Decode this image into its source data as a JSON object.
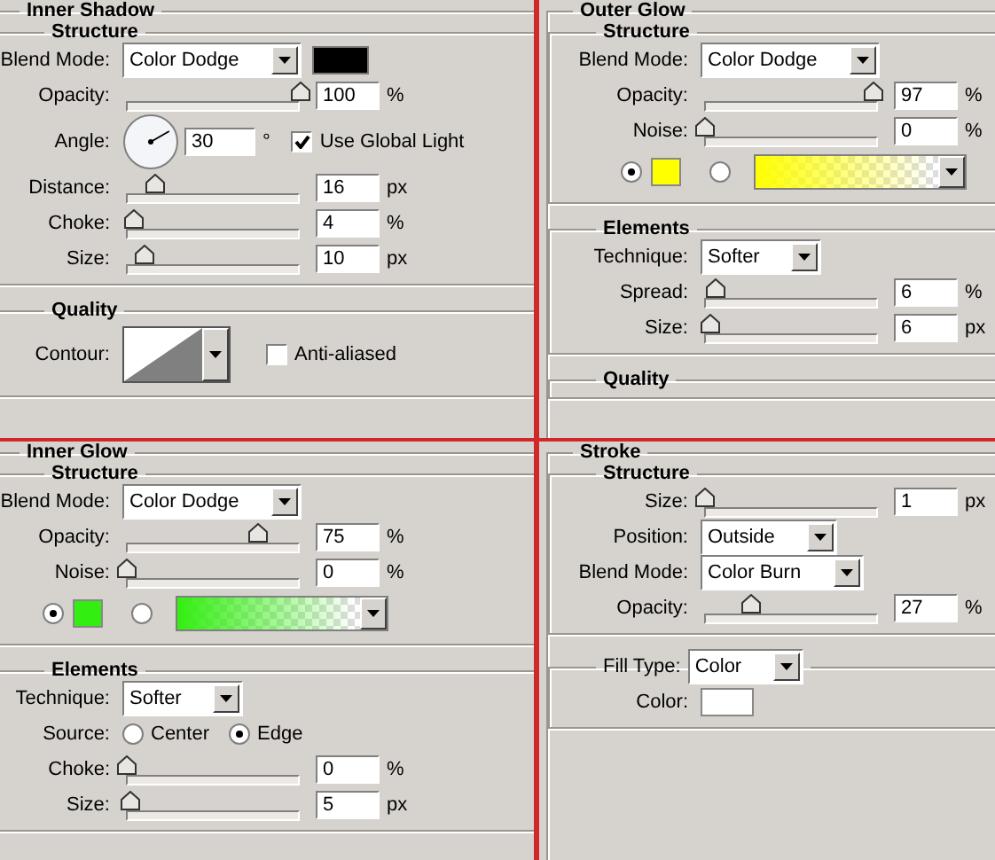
{
  "panels": [
    {
      "title": "Inner Shadow",
      "sections": [
        {
          "kind": "plain",
          "title": "Structure",
          "rows": [
            {
              "kind": "select",
              "label": "Blend Mode:",
              "value": "Color Dodge",
              "color": "#000000"
            },
            {
              "kind": "slider",
              "label": "Opacity:",
              "level": 1.0,
              "value": "100",
              "unit": "%"
            },
            {
              "kind": "angle",
              "label": "Angle:",
              "value": "30",
              "unit": "°",
              "checkbox": {
                "label": "Use Global Light",
                "checked": true
              }
            },
            {
              "kind": "slider",
              "label": "Distance:",
              "level": 0.16,
              "value": "16",
              "unit": "px"
            },
            {
              "kind": "slider",
              "label": "Choke:",
              "level": 0.04,
              "value": "4",
              "unit": "%"
            },
            {
              "kind": "slider",
              "label": "Size:",
              "level": 0.1,
              "value": "10",
              "unit": "px"
            }
          ]
        },
        {
          "kind": "plain",
          "title": "Quality",
          "rows": [
            {
              "kind": "contour",
              "label": "Contour:",
              "checkbox": {
                "label": "Anti-aliased",
                "checked": false
              }
            }
          ]
        }
      ]
    },
    {
      "title": "Outer Glow",
      "sections": [
        {
          "kind": "plain",
          "title": "Structure",
          "rows": [
            {
              "kind": "select",
              "label": "Blend Mode:",
              "value": "Color Dodge"
            },
            {
              "kind": "slider",
              "label": "Opacity:",
              "level": 0.97,
              "value": "97",
              "unit": "%"
            },
            {
              "kind": "slider",
              "label": "Noise:",
              "level": 0,
              "value": "0",
              "unit": "%"
            },
            {
              "kind": "fill",
              "options": [
                {
                  "kind": "solid",
                  "selected": true,
                  "color": "#ffff00"
                },
                {
                  "kind": "gradient",
                  "selected": false,
                  "color": "#ffff00"
                }
              ]
            }
          ]
        },
        {
          "kind": "plain",
          "title": "Elements",
          "rows": [
            {
              "kind": "select",
              "label": "Technique:",
              "value": "Softer"
            },
            {
              "kind": "slider",
              "label": "Spread:",
              "level": 0.06,
              "value": "6",
              "unit": "%"
            },
            {
              "kind": "slider",
              "label": "Size:",
              "level": 0.03,
              "value": "6",
              "unit": "px"
            }
          ]
        },
        {
          "kind": "plain",
          "title": "Quality"
        }
      ]
    },
    {
      "title": "Inner Glow",
      "sections": [
        {
          "kind": "plain",
          "title": "Structure",
          "rows": [
            {
              "kind": "select",
              "label": "Blend Mode:",
              "value": "Color Dodge"
            },
            {
              "kind": "slider",
              "label": "Opacity:",
              "level": 0.75,
              "value": "75",
              "unit": "%"
            },
            {
              "kind": "slider",
              "label": "Noise:",
              "level": 0,
              "value": "0",
              "unit": "%"
            },
            {
              "kind": "fill",
              "options": [
                {
                  "kind": "solid",
                  "selected": true,
                  "color": "#33ee11"
                },
                {
                  "kind": "gradient",
                  "selected": false,
                  "color": "#33ee11"
                }
              ]
            }
          ]
        },
        {
          "kind": "plain",
          "title": "Elements",
          "rows": [
            {
              "kind": "select",
              "label": "Technique:",
              "value": "Softer"
            },
            {
              "kind": "radios",
              "label": "Source:",
              "options": [
                {
                  "label": "Center",
                  "selected": false
                },
                {
                  "label": "Edge",
                  "selected": true
                }
              ]
            },
            {
              "kind": "slider",
              "label": "Choke:",
              "level": 0,
              "value": "0",
              "unit": "%"
            },
            {
              "kind": "slider",
              "label": "Size:",
              "level": 0.02,
              "value": "5",
              "unit": "px"
            }
          ]
        }
      ]
    },
    {
      "title": "Stroke",
      "sections": [
        {
          "kind": "plain",
          "title": "Structure",
          "rows": [
            {
              "kind": "slider",
              "label": "Size:",
              "level": 0,
              "value": "1",
              "unit": "px"
            },
            {
              "kind": "select",
              "label": "Position:",
              "value": "Outside"
            },
            {
              "kind": "select",
              "label": "Blend Mode:",
              "value": "Color Burn"
            },
            {
              "kind": "slider",
              "label": "Opacity:",
              "level": 0.27,
              "value": "27",
              "unit": "%"
            }
          ]
        },
        {
          "kind": "select",
          "title": "Fill Type:",
          "value": "Color",
          "rows": [
            {
              "kind": "swatch",
              "label": "Color:",
              "color": "#ffffff"
            }
          ]
        }
      ]
    }
  ]
}
